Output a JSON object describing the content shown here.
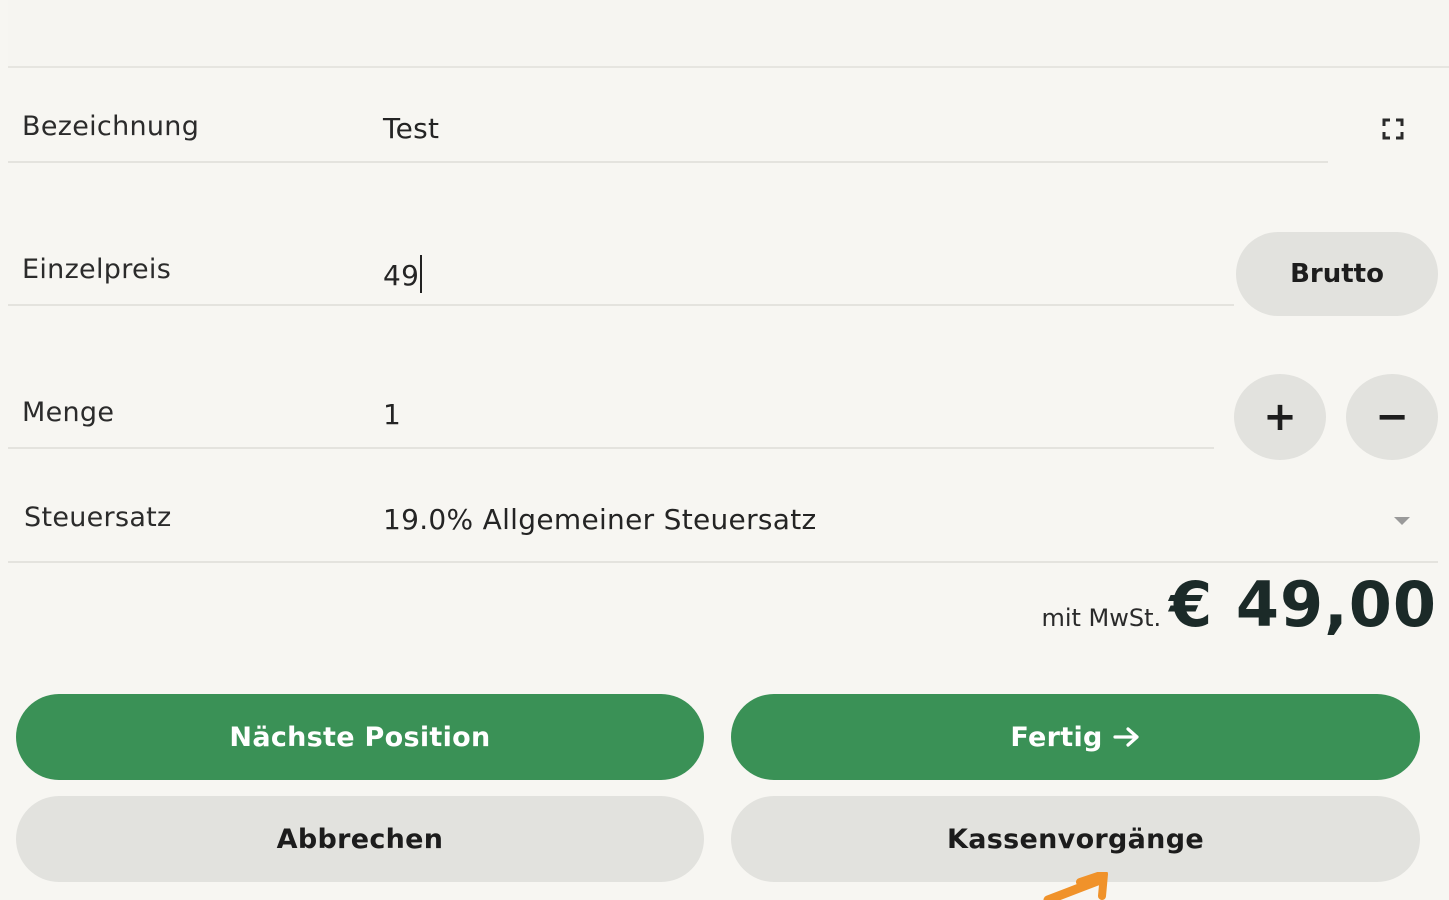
{
  "form": {
    "bezeichnung": {
      "label": "Bezeichnung",
      "value": "Test"
    },
    "einzelpreis": {
      "label": "Einzelpreis",
      "value": "49",
      "mode_button": "Brutto"
    },
    "menge": {
      "label": "Menge",
      "value": "1",
      "plus": "+",
      "minus": "−"
    },
    "steuersatz": {
      "label": "Steuersatz",
      "value": "19.0% Allgemeiner Steuersatz"
    }
  },
  "total": {
    "suffix": "mit MwSt.",
    "amount": "€ 49,00"
  },
  "actions": {
    "next_position": "Nächste Position",
    "done": "Fertig",
    "cancel": "Abbrechen",
    "cash_operations": "Kassenvorgänge"
  },
  "icons": {
    "expand": "expand-icon",
    "dropdown": "chevron-down-icon",
    "arrow": "arrow-right-icon"
  },
  "colors": {
    "primary": "#3a9156",
    "secondary": "#e2e2de",
    "annotation": "#f0922a"
  }
}
